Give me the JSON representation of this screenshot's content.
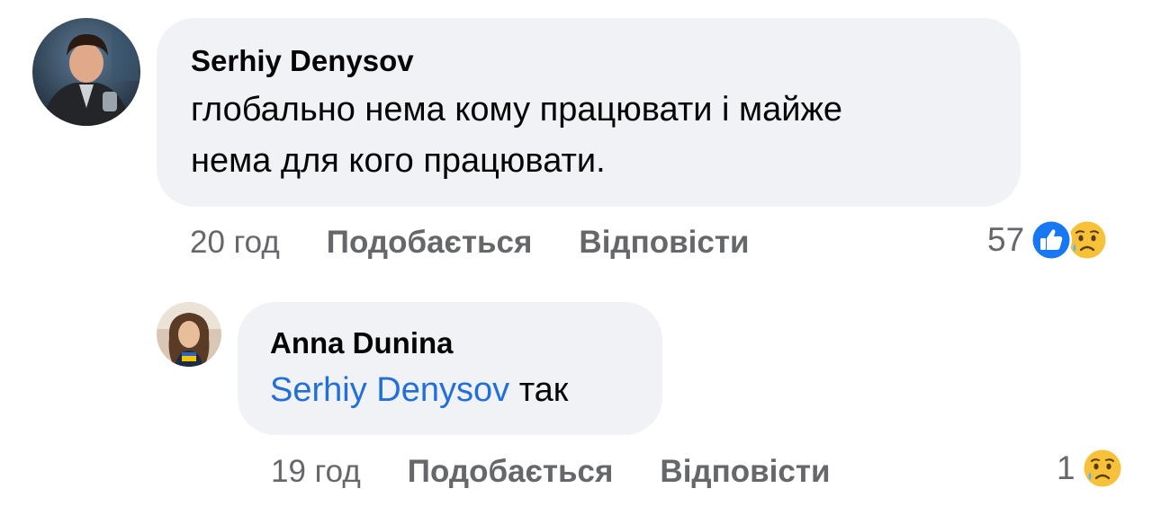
{
  "comments": [
    {
      "author": "Serhiy Denysov",
      "text_lines": [
        "глобально нема кому працювати і майже",
        "нема для кого працювати."
      ],
      "time": "20 год",
      "like_label": "Подобається",
      "reply_label": "Відповісти",
      "reaction_count": "57",
      "reaction_icons": [
        "like-icon",
        "sad-icon"
      ]
    }
  ],
  "replies": [
    {
      "author": "Anna Dunina",
      "mention": "Serhiy Denysov",
      "text": "так",
      "time": "19 год",
      "like_label": "Подобається",
      "reply_label": "Відповісти",
      "reaction_count": "1",
      "reaction_icons": [
        "sad-icon"
      ]
    }
  ],
  "colors": {
    "bubble": "#f0f2f5",
    "secondary_text": "#65676b",
    "mention": "#216fdb",
    "like_blue": "#1877f2",
    "sad_yellow": "#f7c23a"
  }
}
